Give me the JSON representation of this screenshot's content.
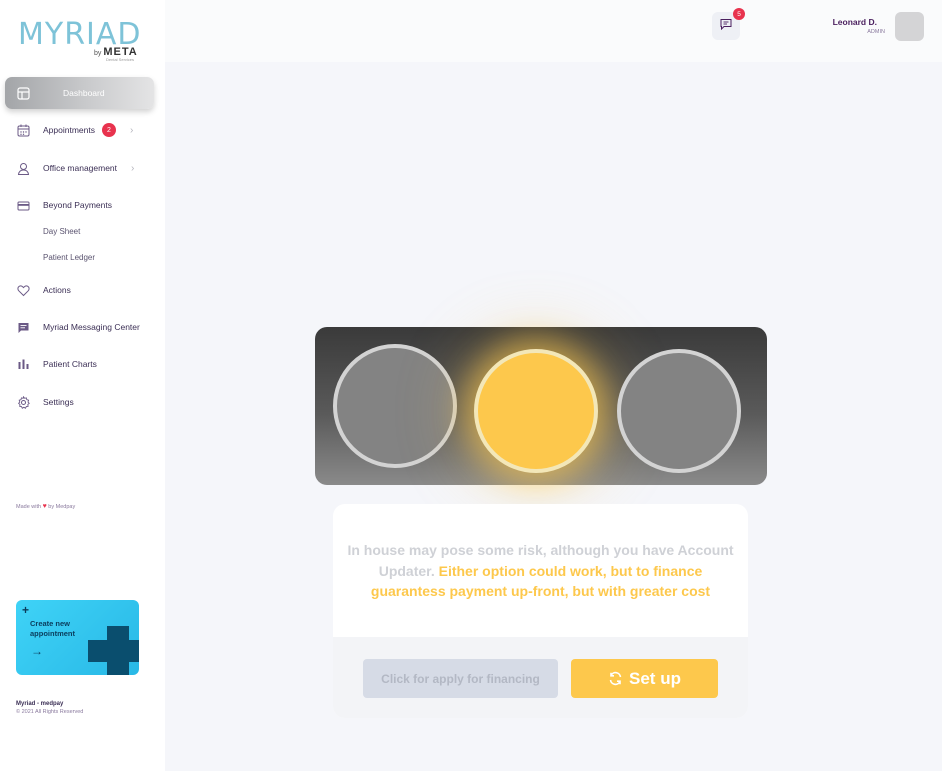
{
  "brand": {
    "logo_text": "MYRIAD",
    "logo_by": "by",
    "logo_meta": "META",
    "logo_tag": "Dental Services"
  },
  "sidebar": {
    "items": [
      {
        "label": "Dashboard",
        "icon": "dashboard-icon"
      },
      {
        "label": "Appointments",
        "icon": "calendar-icon",
        "badge": "2"
      },
      {
        "label": "Office management",
        "icon": "user-icon"
      },
      {
        "label": "Beyond Payments",
        "icon": "card-icon"
      },
      {
        "label": "Actions",
        "icon": "heart-icon"
      },
      {
        "label": "Myriad Messaging Center",
        "icon": "chat-icon"
      },
      {
        "label": "Patient Charts",
        "icon": "bar-chart-icon"
      },
      {
        "label": "Settings",
        "icon": "gear-icon"
      }
    ],
    "sub_items": [
      "Day Sheet",
      "Patient Ledger"
    ],
    "made_with_prefix": "Made with",
    "made_with_suffix": "by Medpay"
  },
  "create_card": {
    "label": "Create new appointment"
  },
  "footer": {
    "brand": "Myriad - medpay",
    "copyright": "© 2021 All Rights Reserved"
  },
  "header": {
    "message_count": "5",
    "user_name": "Leonard D.",
    "user_role": "ADMIN"
  },
  "traffic_light": {
    "active": "yellow",
    "colors": {
      "on": "#fdc84c",
      "off": "#838383"
    }
  },
  "message": {
    "grey_text": "In house may pose some risk, although you have Account Updater.",
    "yellow_text": "Either option could work, but to finance guarantess payment up-front, but with greater cost"
  },
  "buttons": {
    "finance_label": "Click for apply for financing",
    "setup_label": "Set up"
  }
}
